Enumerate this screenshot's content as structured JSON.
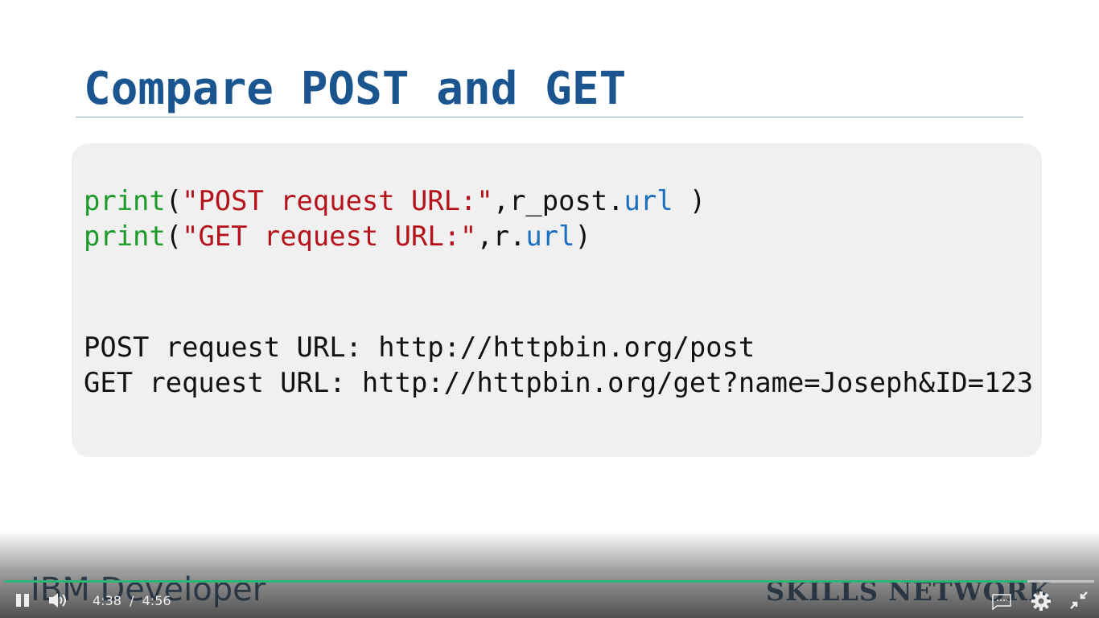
{
  "slide": {
    "title": "Compare POST and GET",
    "code": {
      "line1": {
        "fn": "print",
        "open": "(",
        "str": "\"POST request URL:\"",
        "mid": ",r_post.",
        "attr": "url",
        "close": " )"
      },
      "line2": {
        "fn": "print",
        "open": "(",
        "str": "\"GET request URL:\"",
        "mid": ",r.",
        "attr": "url",
        "close": ")"
      }
    },
    "output": [
      "POST request URL: http://httpbin.org/post",
      "GET request URL: http://httpbin.org/get?name=Joseph&ID=123"
    ],
    "watermark_left": "IBM Developer",
    "watermark_right": "SKILLS NETWORK"
  },
  "player": {
    "current_time": "4:38",
    "separator": "/",
    "duration": "4:56",
    "progress": 0.939,
    "accent": "#2bb673"
  }
}
